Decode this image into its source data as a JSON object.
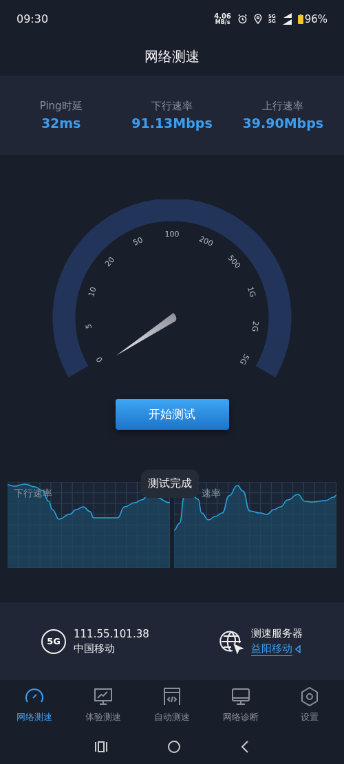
{
  "status_bar": {
    "time": "09:30",
    "net_speed": "4.06",
    "net_unit": "MB/s",
    "sim_1": "5G",
    "sim_2": "5G",
    "battery": "96%"
  },
  "title": "网络测速",
  "stats": [
    {
      "label": "Ping时延",
      "value": "32ms"
    },
    {
      "label": "下行速率",
      "value": "91.13Mbps"
    },
    {
      "label": "上行速率",
      "value": "39.90Mbps"
    }
  ],
  "gauge": {
    "scale": [
      "0",
      "5",
      "10",
      "20",
      "50",
      "100",
      "200",
      "500",
      "1G",
      "2G",
      "5G"
    ]
  },
  "start_button": "开始测试",
  "charts": [
    {
      "label": "下行速率"
    },
    {
      "label": "速率"
    }
  ],
  "toast": "测试完成",
  "connection": {
    "network_badge": "5G",
    "ip": "111.55.101.38",
    "carrier": "中国移动"
  },
  "server": {
    "title": "测速服务器",
    "name": "益阳移动"
  },
  "tabs": [
    {
      "label": "网络测速",
      "kind": "gauge",
      "selected": true
    },
    {
      "label": "体验测速",
      "kind": "chart",
      "selected": false
    },
    {
      "label": "自动测速",
      "kind": "code",
      "selected": false
    },
    {
      "label": "网络诊断",
      "kind": "monitor",
      "selected": false
    },
    {
      "label": "设置",
      "kind": "settings",
      "selected": false
    }
  ]
}
